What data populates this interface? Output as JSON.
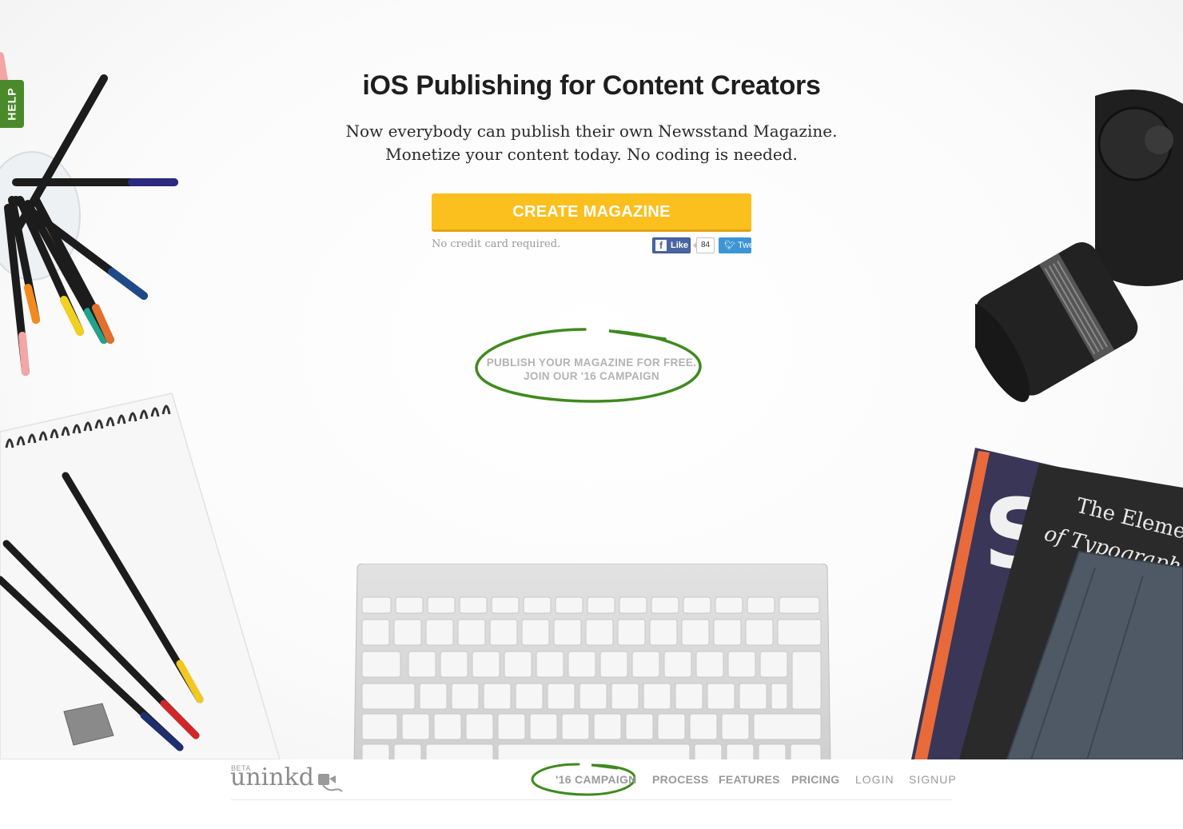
{
  "help": {
    "label": "HELP"
  },
  "hero": {
    "title": "iOS Publishing for Content Creators",
    "subtitle_line1": "Now everybody can publish their own Newsstand Magazine.",
    "subtitle_line2": "Monetize your content today. No coding is needed.",
    "cta_label": "CREATE MAGAZINE",
    "note": "No credit card required."
  },
  "social": {
    "fb_like_label": "Like",
    "fb_count": "84",
    "tweet_label": "Tweet"
  },
  "campaign": {
    "line1": "PUBLISH YOUR MAGAZINE FOR FREE.",
    "line2": "JOIN OUR '16 CAMPAIGN"
  },
  "footer": {
    "beta": "BETA",
    "logo": "uninkd",
    "nav": [
      {
        "label": "'16 CAMPAIGN"
      },
      {
        "label": "PROCESS"
      },
      {
        "label": "FEATURES"
      },
      {
        "label": "PRICING"
      },
      {
        "label": "LOGIN"
      },
      {
        "label": "SIGNUP"
      }
    ]
  },
  "book": {
    "title_line1": "The Elements",
    "title_line2": "of Typographic Style"
  },
  "colors": {
    "cta": "#fbbf1e",
    "help": "#4a8a2a",
    "circle": "#3f8a1f"
  }
}
